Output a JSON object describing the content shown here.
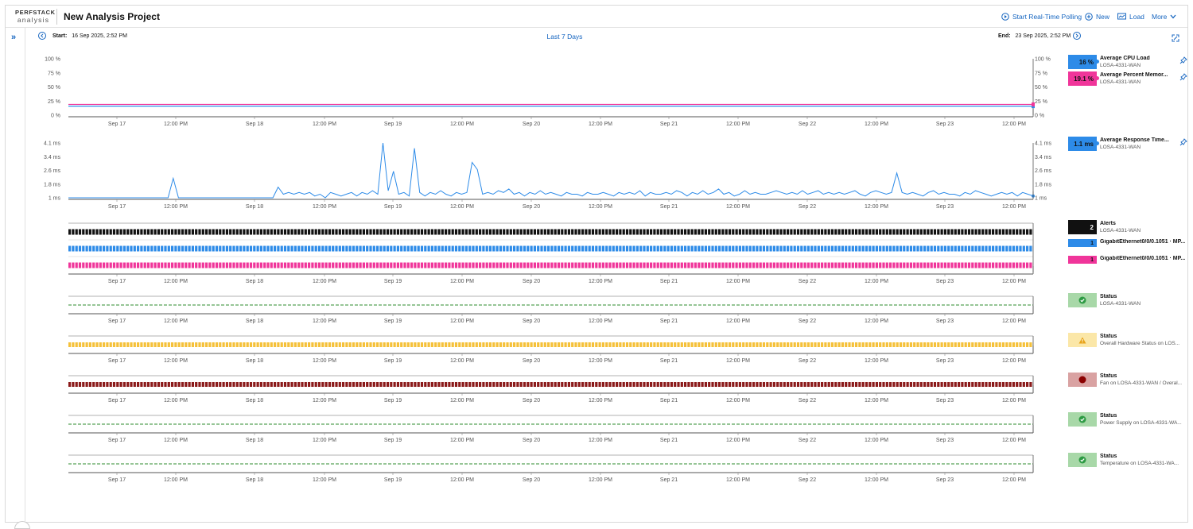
{
  "app": {
    "logo_top": "PERFSTACK",
    "logo_bottom": "analysis",
    "project_title": "New Analysis Project"
  },
  "toolbar": {
    "realtime": "Start Real-Time Polling",
    "new": "New",
    "load": "Load",
    "more": "More"
  },
  "timebar": {
    "start_label": "Start:",
    "start_value": "16 Sep 2025, 2:52 PM",
    "range": "Last 7 Days",
    "end_label": "End:",
    "end_value": "23 Sep 2025, 2:52 PM"
  },
  "x_ticks": [
    "Sep 17",
    "12:00 PM",
    "Sep 18",
    "12:00 PM",
    "Sep 19",
    "12:00 PM",
    "Sep 20",
    "12:00 PM",
    "Sep 21",
    "12:00 PM",
    "Sep 22",
    "12:00 PM",
    "Sep 23",
    "12:00 PM"
  ],
  "colors": {
    "blue": "#2d8be8",
    "pink": "#f0359a",
    "black": "#111111",
    "green": "#2e8b2e",
    "yellow": "#f5c13a",
    "darkred": "#8b1a1a",
    "link": "#1565c0"
  },
  "chart_data": [
    {
      "type": "line",
      "title": "",
      "y_ticks": [
        "100 %",
        "75 %",
        "50 %",
        "25 %",
        "0 %"
      ],
      "ylim": [
        0,
        100
      ],
      "series": [
        {
          "name": "Average CPU Load",
          "values": [
            16,
            16
          ]
        },
        {
          "name": "Average Percent Memory Used",
          "values": [
            19.1,
            19.1
          ]
        }
      ]
    },
    {
      "type": "line",
      "title": "",
      "y_ticks": [
        "4.1 ms",
        "3.4 ms",
        "2.6 ms",
        "1.8 ms",
        "1 ms"
      ],
      "ylim": [
        1,
        4.1
      ],
      "series": [
        {
          "name": "Average Response Time",
          "values": [
            1,
            1,
            1,
            1,
            1,
            1,
            1,
            1,
            1,
            1,
            1,
            1,
            1,
            1,
            1,
            1,
            1,
            1,
            1,
            1,
            2.1,
            1,
            1,
            1,
            1,
            1,
            1,
            1,
            1,
            1,
            1,
            1,
            1,
            1,
            1,
            1,
            1,
            1,
            1,
            1,
            1.6,
            1.2,
            1.3,
            1.2,
            1.3,
            1.2,
            1.3,
            1.1,
            1.2,
            1,
            1.3,
            1.2,
            1.1,
            1.2,
            1.3,
            1.1,
            1.3,
            1.2,
            1.4,
            1.2,
            4.1,
            1.4,
            2.5,
            1.2,
            1.3,
            1.1,
            3.8,
            1.3,
            1.1,
            1.3,
            1.2,
            1.4,
            1.2,
            1.1,
            1.3,
            1.2,
            1.3,
            3.0,
            2.6,
            1.2,
            1.3,
            1.2,
            1.4,
            1.3,
            1.5,
            1.2,
            1.3,
            1.1,
            1.3,
            1.2,
            1.4,
            1.2,
            1.3,
            1.2,
            1.1,
            1.3,
            1.2,
            1.2,
            1.1,
            1.3,
            1.2,
            1.2,
            1.3,
            1.2,
            1.1,
            1.3,
            1.2,
            1.3,
            1.2,
            1.4,
            1.1,
            1.3,
            1.2,
            1.2,
            1.3,
            1.2,
            1.4,
            1.3,
            1.1,
            1.3,
            1.2,
            1.4,
            1.2,
            1.3,
            1.5,
            1.2,
            1.3,
            1.1,
            1.2,
            1.4,
            1.2,
            1.3,
            1.2,
            1.2,
            1.3,
            1.4,
            1.3,
            1.2,
            1.3,
            1.2,
            1.4,
            1.2,
            1.3,
            1.4,
            1.2,
            1.3,
            1.2,
            1.3,
            1.2,
            1.3,
            1.4,
            1.2,
            1.1,
            1.3,
            1.4,
            1.3,
            1.2,
            1.3,
            2.4,
            1.3,
            1.2,
            1.3,
            1.2,
            1.1,
            1.3,
            1.4,
            1.2,
            1.3,
            1.2,
            1.2,
            1.1,
            1.3,
            1.2,
            1.4,
            1.3,
            1.2,
            1.1,
            1.2,
            1.3,
            1.2,
            1.3,
            1.1,
            1.3,
            1.2,
            1.1
          ]
        }
      ]
    }
  ],
  "legends": {
    "cpu": {
      "value": "16 %",
      "name": "Average CPU Load",
      "sub": "LOSA-4331-WAN"
    },
    "mem": {
      "value": "19.1 %",
      "name": "Average Percent Memor...",
      "sub": "LOSA-4331-WAN"
    },
    "resp": {
      "value": "1.1 ms",
      "name": "Average Response Time...",
      "sub": "LOSA-4331-WAN"
    },
    "alerts": {
      "value": "2",
      "name": "Alerts",
      "sub": "LOSA-4331-WAN"
    },
    "gig1": {
      "value": "1",
      "name": "GigabitEthernet0/0/0.1051 · MP..."
    },
    "gig2": {
      "value": "1",
      "name": "GigabitEthernet0/0/0.1051 · MP..."
    },
    "status1": {
      "name": "Status",
      "sub": "LOSA-4331-WAN",
      "state": "up"
    },
    "status2": {
      "name": "Status",
      "sub": "Overall Hardware Status on LOS...",
      "state": "warning"
    },
    "status3": {
      "name": "Status",
      "sub": "Fan on LOSA-4331-WAN / Overal...",
      "state": "critical"
    },
    "status4": {
      "name": "Status",
      "sub": "Power Supply on LOSA-4331-WA...",
      "state": "up"
    },
    "status5": {
      "name": "Status",
      "sub": "Temperature on LOSA-4331-WA...",
      "state": "up"
    }
  }
}
